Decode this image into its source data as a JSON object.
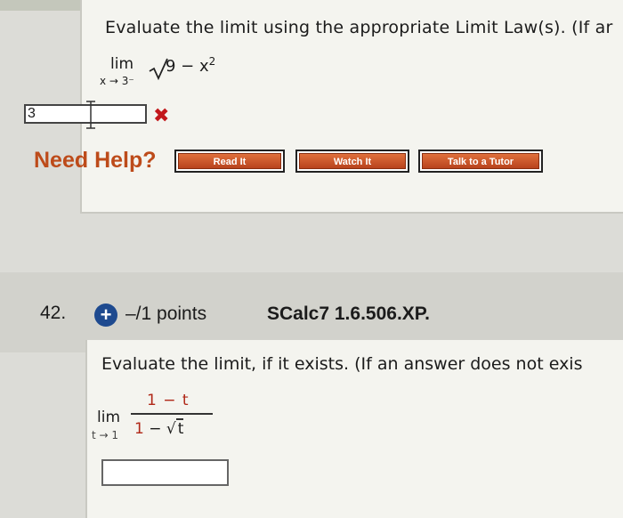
{
  "problem_41": {
    "prompt": "Evaluate the limit using the appropriate Limit Law(s). (If ar",
    "limit_word": "lim",
    "limit_subscript": "x → 3⁻",
    "radicand": "9 − x",
    "radicand_exponent": "2",
    "answer_value": "3",
    "result_icon": "x-mark-icon",
    "result_color": "#c2171b",
    "need_help_label": "Need Help?",
    "buttons": {
      "read": "Read It",
      "watch": "Watch It",
      "talk": "Talk to a Tutor"
    }
  },
  "problem_42": {
    "number": "42.",
    "points": "–/1 points",
    "source": "SCalc7 1.6.506.XP.",
    "prompt": "Evaluate the limit, if it exists. (If an answer does not exis",
    "limit_word": "lim",
    "limit_subscript": "t → 1",
    "numerator": "1 − t",
    "denominator_prefix": "1",
    "denominator_minus": " − ",
    "denominator_sqrt": "t",
    "answer_value": ""
  },
  "colors": {
    "help_orange": "#bd4b1a",
    "plus_blue": "#1e4a8f",
    "accent_red": "#b02818"
  }
}
